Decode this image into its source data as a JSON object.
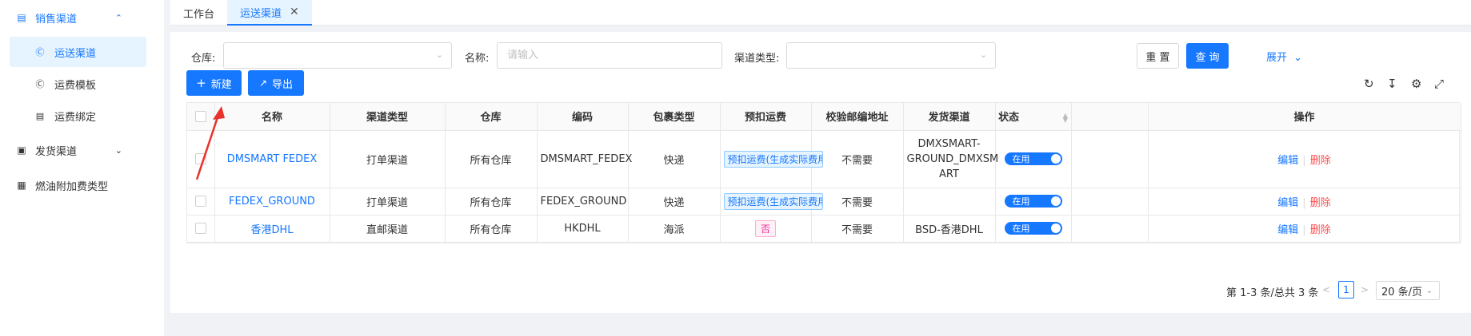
{
  "sidebar": {
    "groups": [
      {
        "label": "销售渠道",
        "icon": "list-icon",
        "expanded": true
      },
      {
        "label": "发货渠道",
        "icon": "box-icon",
        "expanded": false
      },
      {
        "label": "燃油附加费类型",
        "icon": "calendar-icon"
      }
    ],
    "sub_items": [
      {
        "label": "运送渠道",
        "icon": "coin-icon"
      },
      {
        "label": "运费模板",
        "icon": "coin-icon"
      },
      {
        "label": "运费绑定",
        "icon": "list-icon"
      }
    ]
  },
  "tabs": [
    {
      "label": "工作台"
    },
    {
      "label": "运送渠道",
      "closable": true
    }
  ],
  "filters": {
    "warehouse_label": "仓库:",
    "name_label": "名称:",
    "name_placeholder": "请输入",
    "channel_type_label": "渠道类型:"
  },
  "actions": {
    "reset": "重 置",
    "search": "查 询",
    "expand": "展开",
    "new": "新建",
    "export": "导出"
  },
  "table": {
    "columns": [
      "名称",
      "渠道类型",
      "仓库",
      "编码",
      "包裹类型",
      "预扣运费",
      "校验邮编地址",
      "发货渠道",
      "状态",
      "",
      "操作"
    ],
    "rows": [
      {
        "name": "DMSMART FEDEX",
        "channel_type": "打单渠道",
        "warehouse": "所有仓库",
        "code": "DMSMART_FEDEX",
        "package_type": "快递",
        "prepaid": "预扣运费(生成实际费用)",
        "verify_zip": "不需要",
        "ship_channel": "DMXSMART-GROUND_DMXSMART",
        "ship_channel_lines": [
          "DMXSMART-",
          "GROUND_DMXSM",
          "ART"
        ],
        "status": "在用"
      },
      {
        "name": "FEDEX_GROUND",
        "channel_type": "打单渠道",
        "warehouse": "所有仓库",
        "code": "FEDEX_GROUND",
        "package_type": "快递",
        "prepaid": "预扣运费(生成实际费用)",
        "verify_zip": "不需要",
        "ship_channel": "",
        "status": "在用"
      },
      {
        "name": "香港DHL",
        "channel_type": "直邮渠道",
        "warehouse": "所有仓库",
        "code": "HKDHL",
        "package_type": "海派",
        "prepaid": "否",
        "verify_zip": "不需要",
        "ship_channel": "BSD-香港DHL",
        "status": "在用"
      }
    ],
    "edit_label": "编辑",
    "delete_label": "删除"
  },
  "pagination": {
    "summary": "第 1-3 条/总共 3 条",
    "current_page": "1",
    "page_size": "20 条/页"
  },
  "colors": {
    "primary": "#1677ff",
    "danger": "#ff4d4f",
    "annotation_arrow": "#e8322b"
  }
}
